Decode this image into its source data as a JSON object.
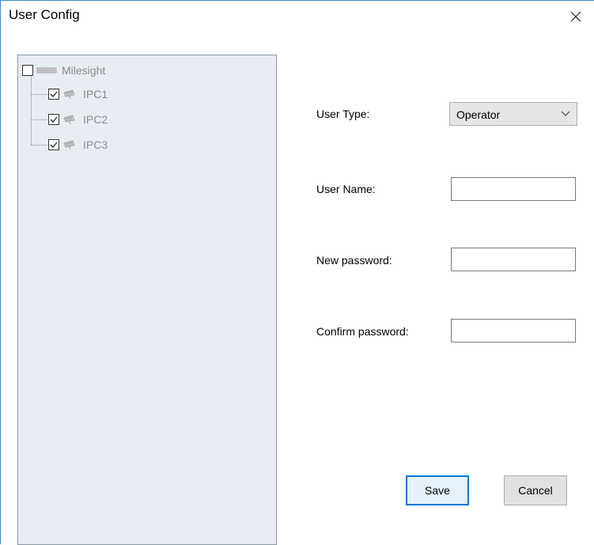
{
  "window": {
    "title": "User Config"
  },
  "tree": {
    "root": {
      "label": "Milesight",
      "checked": false
    },
    "children": [
      {
        "label": "IPC1",
        "checked": true
      },
      {
        "label": "IPC2",
        "checked": true
      },
      {
        "label": "IPC3",
        "checked": true
      }
    ]
  },
  "form": {
    "user_type_label": "User Type:",
    "user_type_value": "Operator",
    "user_name_label": "User Name:",
    "user_name_value": "",
    "new_password_label": "New password:",
    "new_password_value": "",
    "confirm_password_label": "Confirm password:",
    "confirm_password_value": ""
  },
  "buttons": {
    "save_label": "Save",
    "cancel_label": "Cancel"
  },
  "colors": {
    "tree_background": "#e7edf2",
    "accent": "#0078d7"
  }
}
